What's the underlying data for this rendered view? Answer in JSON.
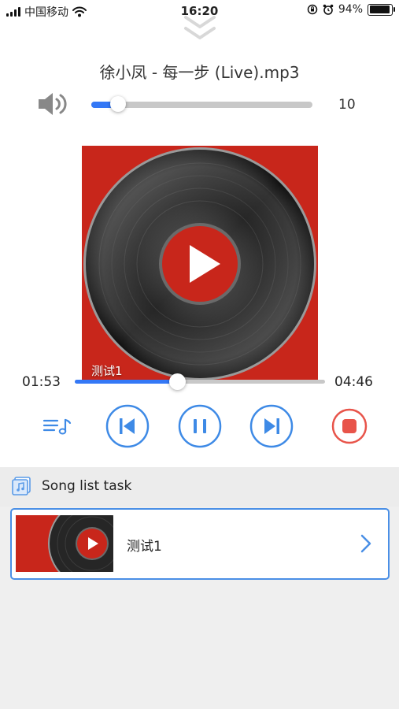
{
  "status_bar": {
    "carrier": "中国移动",
    "time": "16:20",
    "battery_text": "94%",
    "battery_level": 0.94,
    "icons": [
      "signal-icon",
      "wifi-icon",
      "rotation-lock-icon",
      "alarm-icon",
      "battery-icon"
    ]
  },
  "player": {
    "collapse_icon": "double-chevron-down-icon",
    "track_title": "徐小凤 - 每一步 (Live).mp3",
    "volume": {
      "icon": "speaker-icon",
      "value": "10",
      "level": 0.12
    },
    "cover": {
      "label": "测试1",
      "icon": "vinyl-record-icon"
    },
    "progress": {
      "current": "01:53",
      "total": "04:46",
      "fraction": 0.41
    },
    "controls": [
      {
        "name": "playlist-button",
        "icon": "playlist-icon"
      },
      {
        "name": "previous-button",
        "icon": "skip-previous-icon"
      },
      {
        "name": "pause-button",
        "icon": "pause-icon"
      },
      {
        "name": "next-button",
        "icon": "skip-next-icon"
      },
      {
        "name": "stop-button",
        "icon": "stop-icon"
      }
    ]
  },
  "song_list": {
    "title": "Song list task",
    "icon": "music-note-icon",
    "items": [
      {
        "label": "测试1",
        "icon": "chevron-right-icon"
      }
    ]
  },
  "colors": {
    "accent": "#3478f6",
    "stop": "#e8544a",
    "cover_red": "#c8261b",
    "list_border": "#4a8fe6"
  }
}
